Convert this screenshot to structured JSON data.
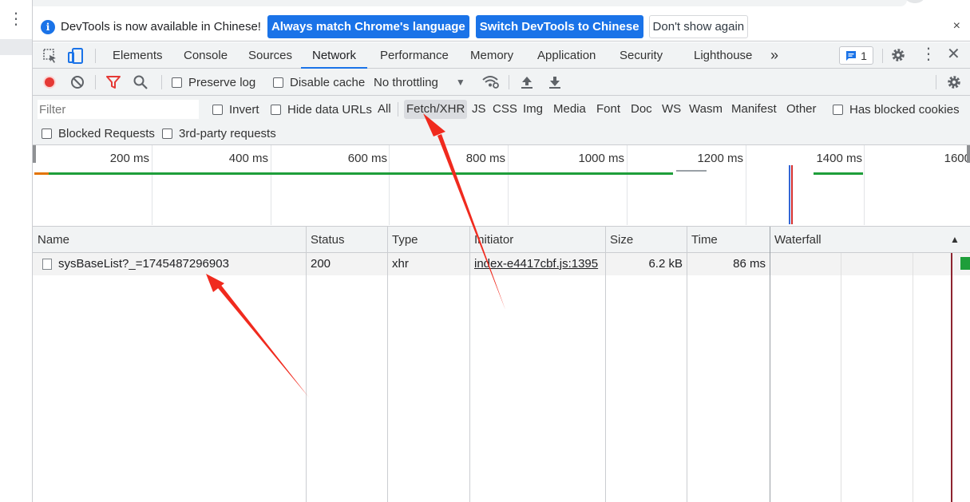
{
  "colors": {
    "accent": "#1a73e8",
    "record_red": "#e53935",
    "filter_red": "#e53935",
    "annotation_red": "#f02a1e",
    "bar_green": "#1e9e3a"
  },
  "infobar": {
    "message": "DevTools is now available in Chinese!",
    "btn_match": "Always match Chrome's language",
    "btn_switch": "Switch DevTools to Chinese",
    "btn_dismiss": "Don't show again",
    "close": "×"
  },
  "tabs": [
    "Elements",
    "Console",
    "Sources",
    "Network",
    "Performance",
    "Memory",
    "Application",
    "Security",
    "Lighthouse"
  ],
  "active_tab": "Network",
  "more_tabs": "»",
  "issues_count": "1",
  "toolbar": {
    "preserve_log": "Preserve log",
    "disable_cache": "Disable cache",
    "throttling": "No throttling"
  },
  "filter": {
    "placeholder": "Filter",
    "invert": "Invert",
    "hide_data_urls": "Hide data URLs",
    "types": [
      "All",
      "Fetch/XHR",
      "JS",
      "CSS",
      "Img",
      "Media",
      "Font",
      "Doc",
      "WS",
      "Wasm",
      "Manifest",
      "Other"
    ],
    "selected_type": "Fetch/XHR",
    "has_blocked_cookies": "Has blocked cookies",
    "blocked_requests": "Blocked Requests",
    "third_party": "3rd-party requests"
  },
  "overview": {
    "ticks": [
      "200 ms",
      "400 ms",
      "600 ms",
      "800 ms",
      "1000 ms",
      "1200 ms",
      "1400 ms",
      "1600"
    ]
  },
  "table": {
    "headers": {
      "name": "Name",
      "status": "Status",
      "type": "Type",
      "initiator": "Initiator",
      "size": "Size",
      "time": "Time",
      "waterfall": "Waterfall"
    },
    "sort_indicator": "▲",
    "rows": [
      {
        "name": "sysBaseList?_=1745487296903",
        "status": "200",
        "type": "xhr",
        "initiator": "index-e4417cbf.js:1395",
        "size": "6.2 kB",
        "time": "86 ms"
      }
    ]
  }
}
